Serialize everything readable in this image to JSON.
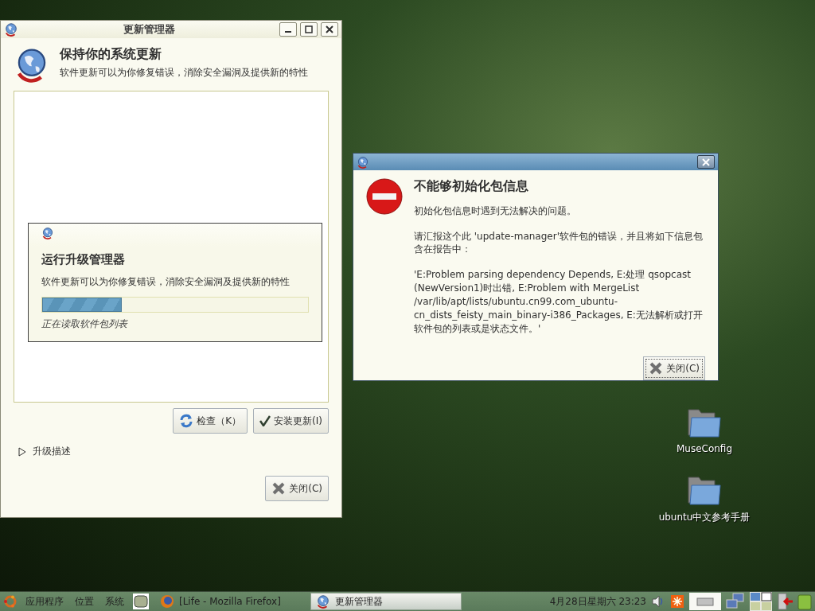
{
  "update_window": {
    "title": "更新管理器",
    "heading": "保持你的系统更新",
    "subheading": "软件更新可以为你修复错误，消除安全漏洞及提供新的特性",
    "progress_dialog": {
      "title": "运行升级管理器",
      "text": "软件更新可以为你修复错误，消除安全漏洞及提供新的特性",
      "level": 0.3,
      "status": "正在读取软件包列表"
    },
    "buttons": [
      {
        "kind": "refresh",
        "label": "检查（K）"
      },
      {
        "kind": "apply",
        "label": "安装更新(I)"
      }
    ],
    "expander": {
      "label": "升级描述",
      "expanded": false
    },
    "close_button": "关闭(C)"
  },
  "error_dialog": {
    "heading": "不能够初始化包信息",
    "message": "初始化包信息时遇到无法解决的问题。",
    "report_text": "请汇报这个此 'update-manager'软件包的错误，并且将如下信息包含在报告中：",
    "error_detail": "'E:Problem parsing dependency Depends, E:处理 qsopcast (NewVersion1)时出错, E:Problem with MergeList /var/lib/apt/lists/ubuntu.cn99.com_ubuntu-cn_dists_feisty_main_binary-i386_Packages, E:无法解析或打开软件包的列表或是状态文件。'",
    "close_button": "关闭(C)"
  },
  "desktop_icons": [
    {
      "label": "MuseConfig"
    },
    {
      "label": "ubuntu中文参考手册"
    }
  ],
  "taskbar": {
    "menus": [
      "应用程序",
      "位置",
      "系统"
    ],
    "tasks": [
      {
        "kind": "firefox",
        "label": "[Life - Mozilla Firefox]",
        "selected": false
      },
      {
        "kind": "update",
        "label": "更新管理器",
        "selected": true
      }
    ],
    "clock": "4月28日星期六 23:23"
  }
}
